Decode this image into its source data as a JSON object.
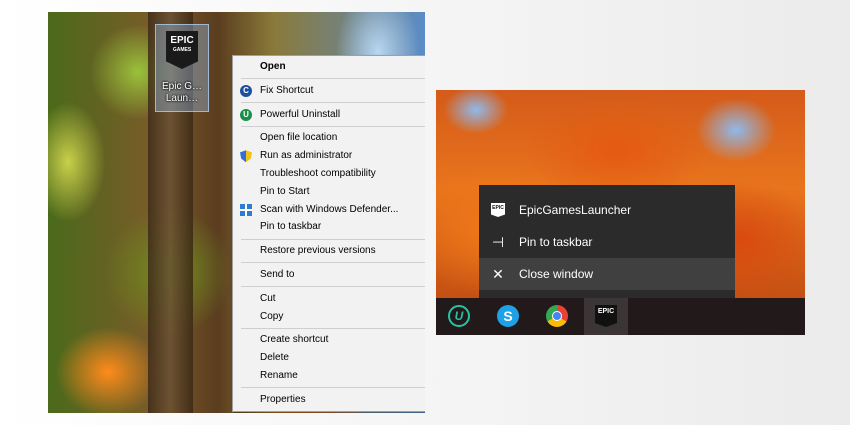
{
  "left_panel": {
    "desktop_icon": {
      "logo_text": "EPIC",
      "logo_sub": "GAMES",
      "label": "Epic G… Laun…"
    },
    "context_menu": {
      "items": [
        {
          "label": "Open",
          "bold": true,
          "icon": null
        },
        {
          "separator": true
        },
        {
          "label": "Fix Shortcut",
          "icon": "ccleaner-icon"
        },
        {
          "separator": true
        },
        {
          "label": "Powerful Uninstall",
          "icon": "uninstall-icon"
        },
        {
          "separator": true
        },
        {
          "label": "Open file location"
        },
        {
          "label": "Run as administrator",
          "icon": "uac-shield-icon"
        },
        {
          "label": "Troubleshoot compatibility"
        },
        {
          "label": "Pin to Start"
        },
        {
          "label": "Scan with Windows Defender...",
          "icon": "defender-icon"
        },
        {
          "label": "Pin to taskbar"
        },
        {
          "separator": true
        },
        {
          "label": "Restore previous versions"
        },
        {
          "separator": true
        },
        {
          "label": "Send to",
          "submenu": true
        },
        {
          "separator": true
        },
        {
          "label": "Cut"
        },
        {
          "label": "Copy"
        },
        {
          "separator": true
        },
        {
          "label": "Create shortcut"
        },
        {
          "label": "Delete"
        },
        {
          "label": "Rename"
        },
        {
          "separator": true
        },
        {
          "label": "Properties"
        }
      ]
    }
  },
  "right_panel": {
    "jump_list": [
      {
        "label": "EpicGamesLauncher",
        "icon": "epic-games-icon",
        "hover": false
      },
      {
        "label": "Pin to taskbar",
        "icon": "pin-icon",
        "hover": false
      },
      {
        "label": "Close window",
        "icon": "close-icon",
        "hover": true
      }
    ],
    "taskbar": [
      {
        "name": "iobit-uninstaller-icon",
        "glyph": "U",
        "active": false
      },
      {
        "name": "skype-icon",
        "glyph": "S",
        "active": false
      },
      {
        "name": "chrome-icon",
        "glyph": "",
        "active": false
      },
      {
        "name": "epic-games-taskbar-icon",
        "glyph": "EPIC",
        "active": true
      }
    ]
  }
}
